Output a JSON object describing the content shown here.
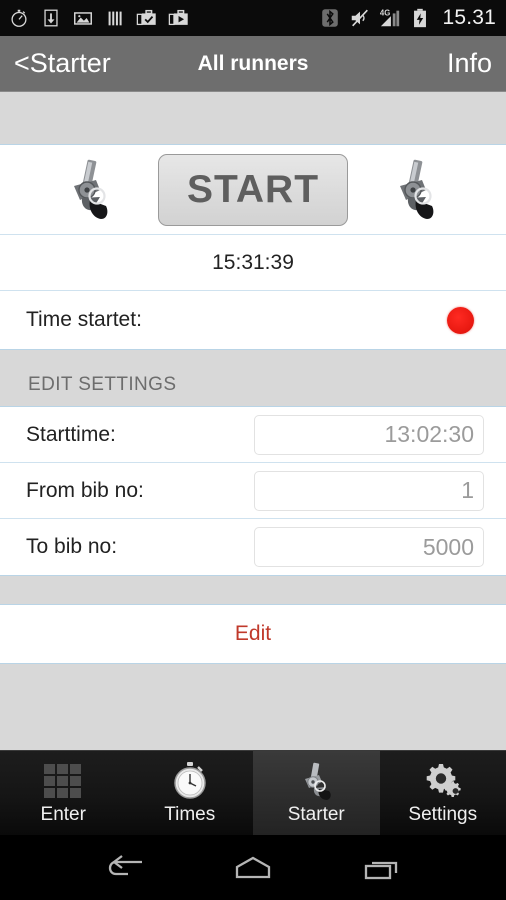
{
  "statusbar": {
    "time": "15.31",
    "left_icons": [
      "stopwatch-icon",
      "download-icon",
      "photo-icon",
      "barcode-icon",
      "briefcase-check-icon",
      "briefcase-play-icon"
    ],
    "right_icons": [
      "bluetooth-icon",
      "mute-icon",
      "signal-4g-icon",
      "battery-charging-icon"
    ]
  },
  "navbar": {
    "back_label": "<Starter",
    "title": "All runners",
    "info_label": "Info"
  },
  "start_section": {
    "start_button_label": "START",
    "left_icon": "starter-pistol-icon",
    "right_icon": "starter-pistol-icon",
    "current_time": "15:31:39",
    "time_started_label": "Time startet:",
    "status_indicator": "red-dot",
    "status_color": "#ea1a12"
  },
  "edit_settings": {
    "section_title": "EDIT SETTINGS",
    "rows": [
      {
        "label": "Starttime:",
        "value": "13:02:30",
        "name": "starttime"
      },
      {
        "label": "From bib no:",
        "value": "1",
        "name": "from-bib-no"
      },
      {
        "label": "To bib no:",
        "value": "5000",
        "name": "to-bib-no"
      }
    ]
  },
  "edit_action": {
    "label": "Edit",
    "color": "#c0392b"
  },
  "tabbar": {
    "tabs": [
      {
        "label": "Enter",
        "icon": "grid-icon",
        "active": false
      },
      {
        "label": "Times",
        "icon": "stopwatch-icon",
        "active": false
      },
      {
        "label": "Starter",
        "icon": "starter-pistol-icon",
        "active": true
      },
      {
        "label": "Settings",
        "icon": "gears-icon",
        "active": false
      }
    ]
  },
  "android_nav": {
    "buttons": [
      "back-icon",
      "home-icon",
      "recents-icon"
    ]
  }
}
